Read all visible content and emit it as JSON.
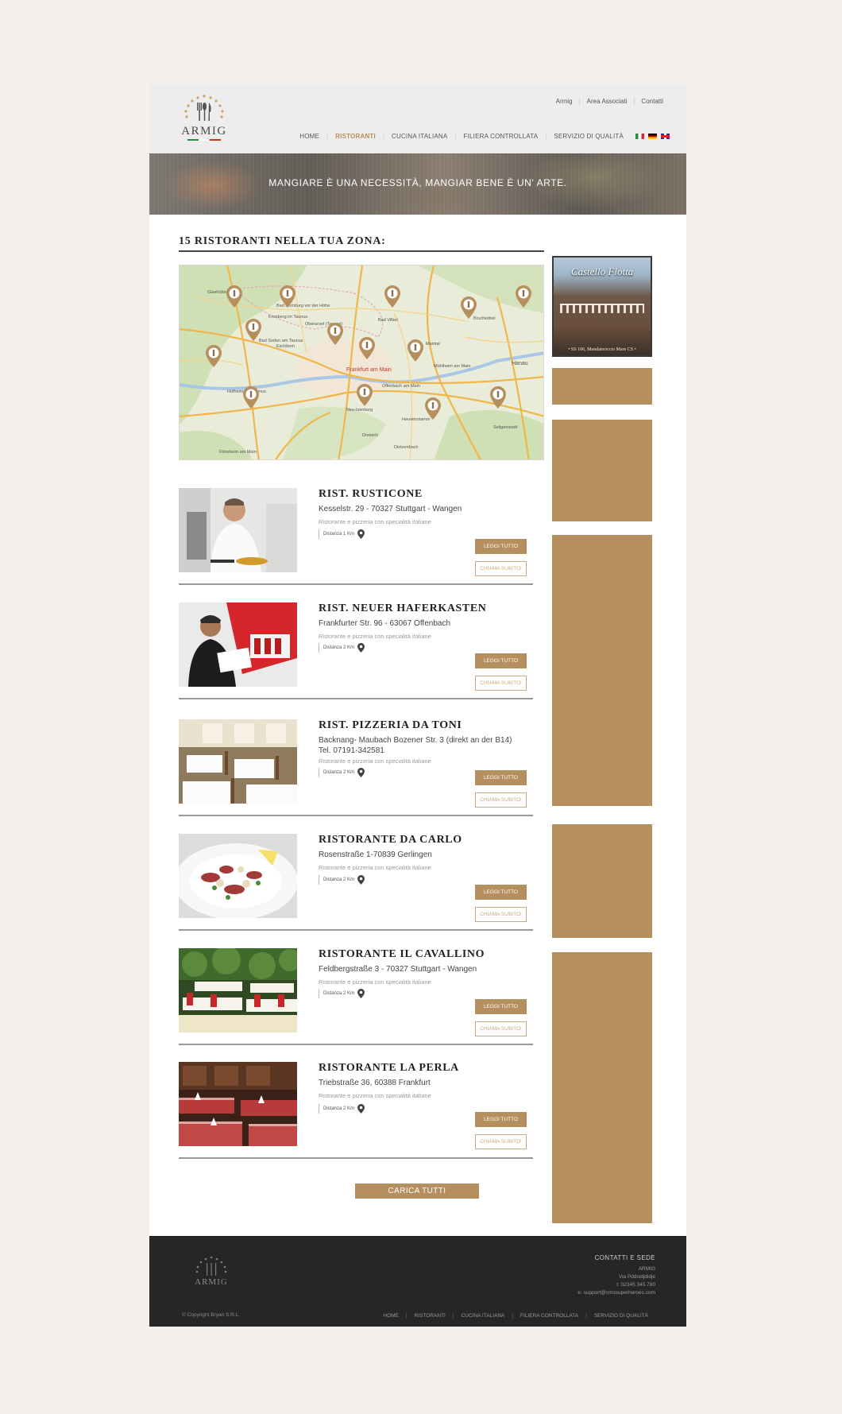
{
  "header": {
    "logo_text": "ARMIG",
    "top_links": [
      "Armig",
      "Area Associati",
      "Contatti"
    ],
    "nav": [
      {
        "label": "HOME",
        "active": false
      },
      {
        "label": "RISTORANTI",
        "active": true
      },
      {
        "label": "CUCINA ITALIANA",
        "active": false
      },
      {
        "label": "FILIERA CONTROLLATA",
        "active": false
      },
      {
        "label": "SERVIZIO DI QUALITÀ",
        "active": false
      }
    ],
    "flags": [
      "flag-it-icon",
      "flag-de-icon",
      "flag-uk-icon"
    ]
  },
  "banner": {
    "tagline": "MANGIARE È UNA NECESSITÀ, MANGIAR BENE È UN' ARTE."
  },
  "main": {
    "section_title": "15 RISTORANTI NELLA TUA ZONA:",
    "map": {
      "labels": [
        "Bad Homburg vor der Höhe",
        "Oberursel (Taunus)",
        "Kronberg im Taunus",
        "Bad Vilbel",
        "Eschborn",
        "Bad Soden am Taunus",
        "Frankfurt am Main",
        "Offenbach am Main",
        "Maintal",
        "Hanau",
        "Mühlheim am Main",
        "Neu-Isenburg",
        "Heusenstamm",
        "Seligenstadt",
        "Dreieich",
        "Dietzenbach",
        "Hofheim am Taunus",
        "Flörsheim am Main",
        "Glashütten",
        "Bruchköbel"
      ]
    },
    "restaurants": [
      {
        "name": "RIST. RUSTICONE",
        "address": "Kesselstr. 29 - 70327 Stuttgart - Wangen",
        "description": "Ristorante e pizzeria con specialità italiane",
        "distance": "Distanza 1 Km",
        "btn_read": "LEGGI TUTTO",
        "btn_call": "CHIAMA SUBITO!"
      },
      {
        "name": "RIST. NEUER HAFERKASTEN",
        "address": "Frankfurter Str. 96 - 63067 Offenbach",
        "description": "Ristorante e pizzeria con specialità italiane",
        "distance": "Distanza 2 Km",
        "btn_read": "LEGGI TUTTO",
        "btn_call": "CHIAMA SUBITO!"
      },
      {
        "name": "RIST. PIZZERIA DA TONI",
        "address": "Backnang- Maubach Bozener Str. 3 (direkt an der B14)",
        "address2": "Tel. 07191-342581",
        "description": "Ristorante e pizzeria con specialità italiane",
        "distance": "Distanza 2 Km",
        "btn_read": "LEGGI TUTTO",
        "btn_call": "CHIAMA SUBITO!"
      },
      {
        "name": "RISTORANTE DA CARLO",
        "address": "Rosenstraße 1-70839 Gerlingen",
        "description": "Ristorante e pizzeria con specialità italiane",
        "distance": "Distanza 2 Km",
        "btn_read": "LEGGI TUTTO",
        "btn_call": "CHIAMA SUBITO!"
      },
      {
        "name": "RISTORANTE IL CAVALLINO",
        "address": "Feldbergstraße 3 - 70327 Stuttgart - Wangen",
        "description": "Ristorante e pizzeria con specialità italiane",
        "distance": "Distanza 2 Km",
        "btn_read": "LEGGI TUTTO",
        "btn_call": "CHIAMA SUBITO!"
      },
      {
        "name": "RISTORANTE LA PERLA",
        "address": "Triebstraße 36, 60388 Frankfurt",
        "description": "Ristorante e pizzeria con specialità italiane",
        "distance": "Distanza 2 Km",
        "btn_read": "LEGGI TUTTO",
        "btn_call": "CHIAMA SUBITO!"
      }
    ],
    "load_all": "CARICA TUTTI"
  },
  "sidebar": {
    "ad_title": "Castello Flotta",
    "ad_caption": "• SS 106, Mandatoriccio Mare CS •",
    "block_color": "#b68f5e"
  },
  "footer": {
    "logo_text": "ARMIG",
    "contact_title": "CONTATTI E SEDE",
    "contact_lines": [
      "ARMIG",
      "Via Pddsidjdidje",
      "t: 02345 345 780",
      "e: support@cmssuperheroes.com"
    ],
    "copyright": "© Copyright Bryan S.R.L.",
    "nav": [
      "HOME",
      "RISTORANTI",
      "CUCINA ITALIANA",
      "FILIERA CONTROLLATA",
      "SERVIZIO DI QUALITÀ"
    ]
  },
  "colors": {
    "accent": "#b68f5e",
    "footer_bg": "#262626",
    "page_bg": "#f3efea"
  }
}
